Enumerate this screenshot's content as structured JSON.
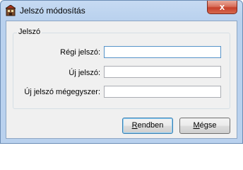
{
  "window": {
    "title": "Jelszó módosítás",
    "close_glyph": "x"
  },
  "group": {
    "legend": "Jelszó"
  },
  "fields": {
    "old_password_label": "Régi jelszó:",
    "new_password_label": "Új jelszó:",
    "confirm_password_label": "Új jelszó mégegyszer:",
    "old_password_value": "",
    "new_password_value": "",
    "confirm_password_value": ""
  },
  "buttons": {
    "ok_mnemonic": "R",
    "ok_rest": "endben",
    "cancel_mnemonic": "M",
    "cancel_rest": "égse"
  },
  "colors": {
    "titlebar": "#c6daf2",
    "client_bg": "#f0f0f0",
    "close_button": "#c6402b",
    "focus_border": "#5793c9"
  },
  "icons": {
    "app": "house-icon",
    "close": "close-icon"
  }
}
